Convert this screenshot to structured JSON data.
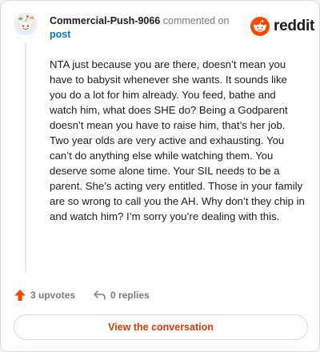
{
  "header": {
    "username": "Commercial-Push-9066",
    "action_text": "commented on",
    "post_link": "post"
  },
  "brand": {
    "wordmark": "reddit",
    "color": "#ff4500"
  },
  "comment": {
    "body": "NTA just because you are there, doesn’t mean you have to babysit whenever she wants. It sounds like you do a lot for him already. You feed, bathe and watch him, what does SHE do? Being a Godparent doesn’t mean you have to raise him, that’s her job. Two year olds are very active and exhausting. You can’t do anything else while watching them. You deserve some alone time. Your SIL needs to be a parent. She’s acting very entitled. Those in your family are so wrong to call you the AH. Why don’t they chip in and watch him? I’m sorry you’re dealing with this."
  },
  "actions": {
    "upvotes": "3 upvotes",
    "replies": "0 replies",
    "upvote_color": "#ff4500"
  },
  "cta": {
    "label": "View the conversation",
    "color": "#d93a00"
  },
  "icons": [
    "avatar",
    "reddit-logo-icon",
    "upvote-icon",
    "reply-icon"
  ]
}
